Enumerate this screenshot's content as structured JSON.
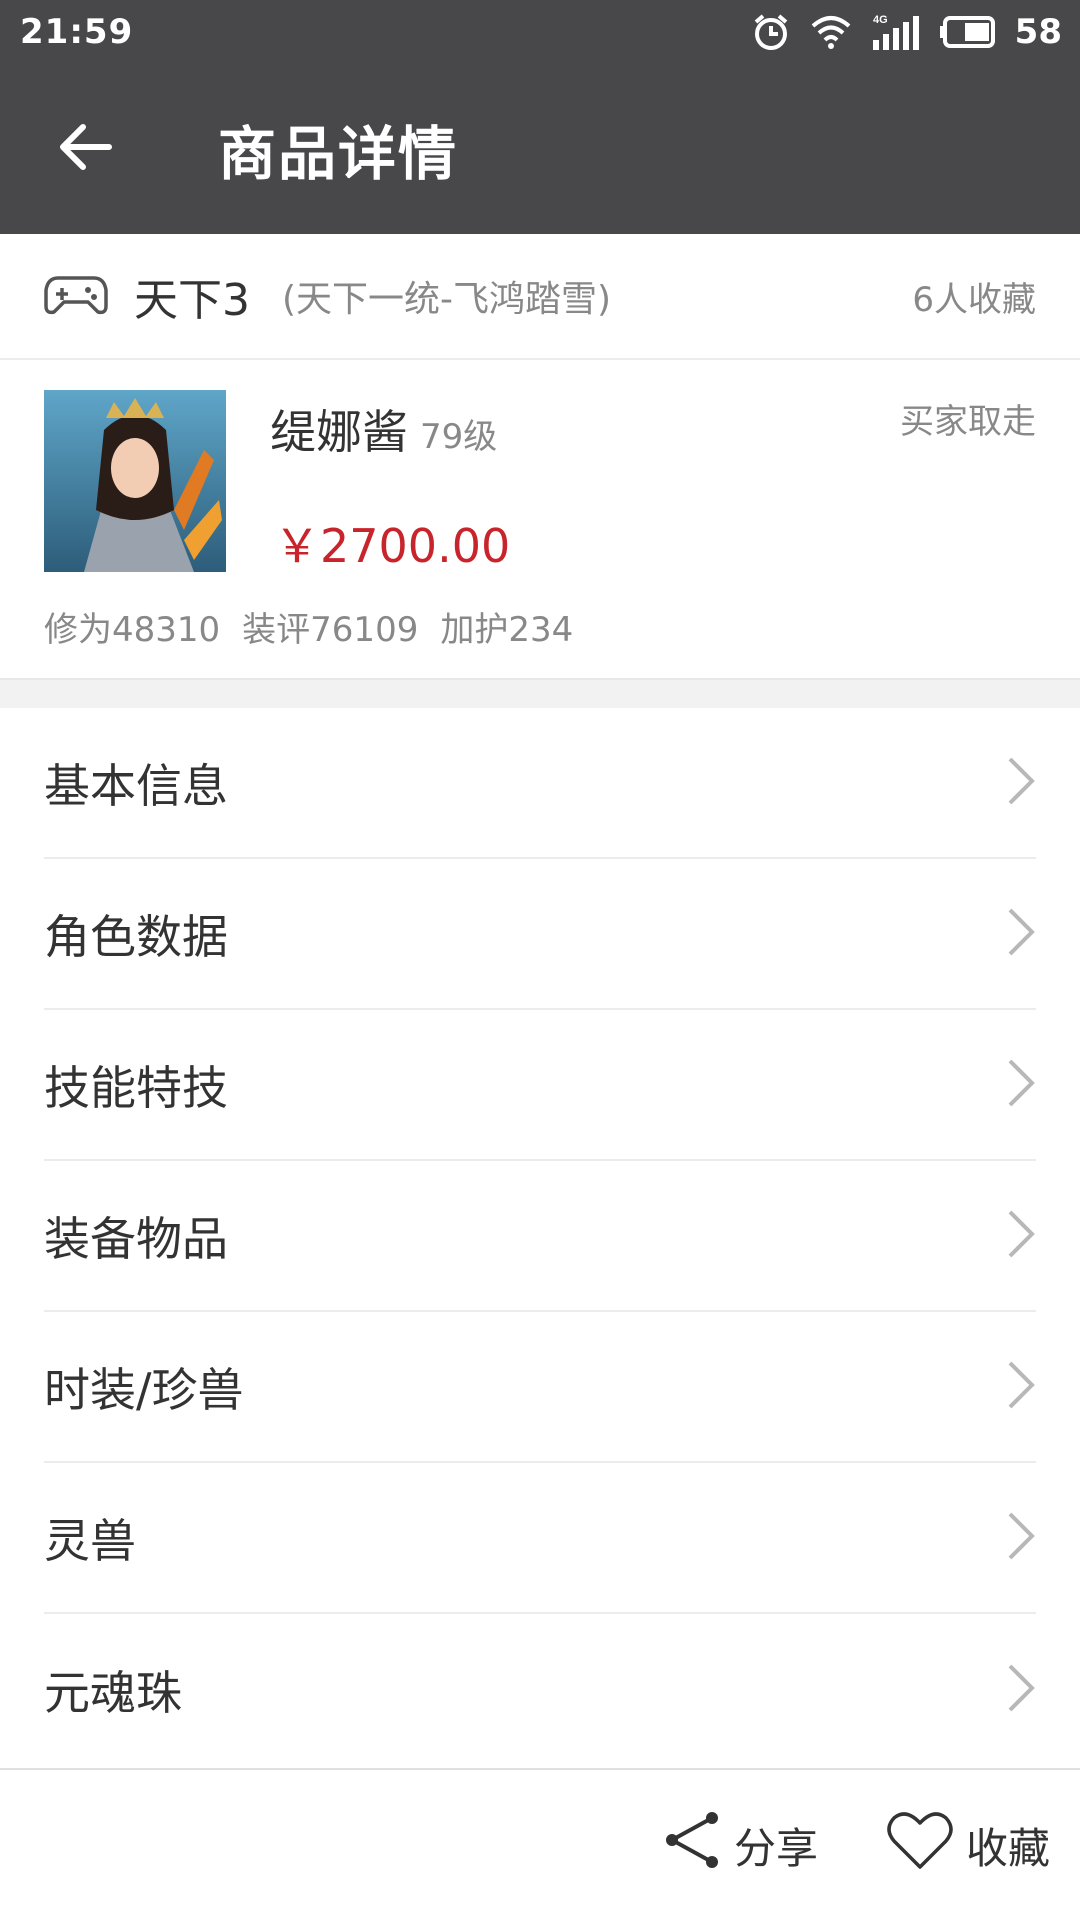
{
  "status_bar": {
    "time": "21:59",
    "battery": "58",
    "icons": [
      "alarm-icon",
      "wifi-icon",
      "signal-4g-icon",
      "battery-icon"
    ]
  },
  "app_bar": {
    "title": "商品详情",
    "back_icon": "back-arrow-icon"
  },
  "game": {
    "icon": "gamepad-icon",
    "name": "天下3",
    "server": "(天下一统-飞鸿踏雪)",
    "favorites": "6人收藏"
  },
  "product": {
    "name": "缇娜酱",
    "level": "79级",
    "status": "买家取走",
    "price": "￥2700.00",
    "stats": [
      "修为48310",
      "装评76109",
      "加护234"
    ]
  },
  "menu": {
    "items": [
      {
        "label": "基本信息"
      },
      {
        "label": "角色数据"
      },
      {
        "label": "技能特技"
      },
      {
        "label": "装备物品"
      },
      {
        "label": "时装/珍兽"
      },
      {
        "label": "灵兽"
      },
      {
        "label": "元魂珠"
      }
    ]
  },
  "bottom_bar": {
    "share_label": "分享",
    "favorite_label": "收藏"
  },
  "colors": {
    "header_bg": "#48484b",
    "price": "#c8242b",
    "muted_text": "#888888"
  }
}
